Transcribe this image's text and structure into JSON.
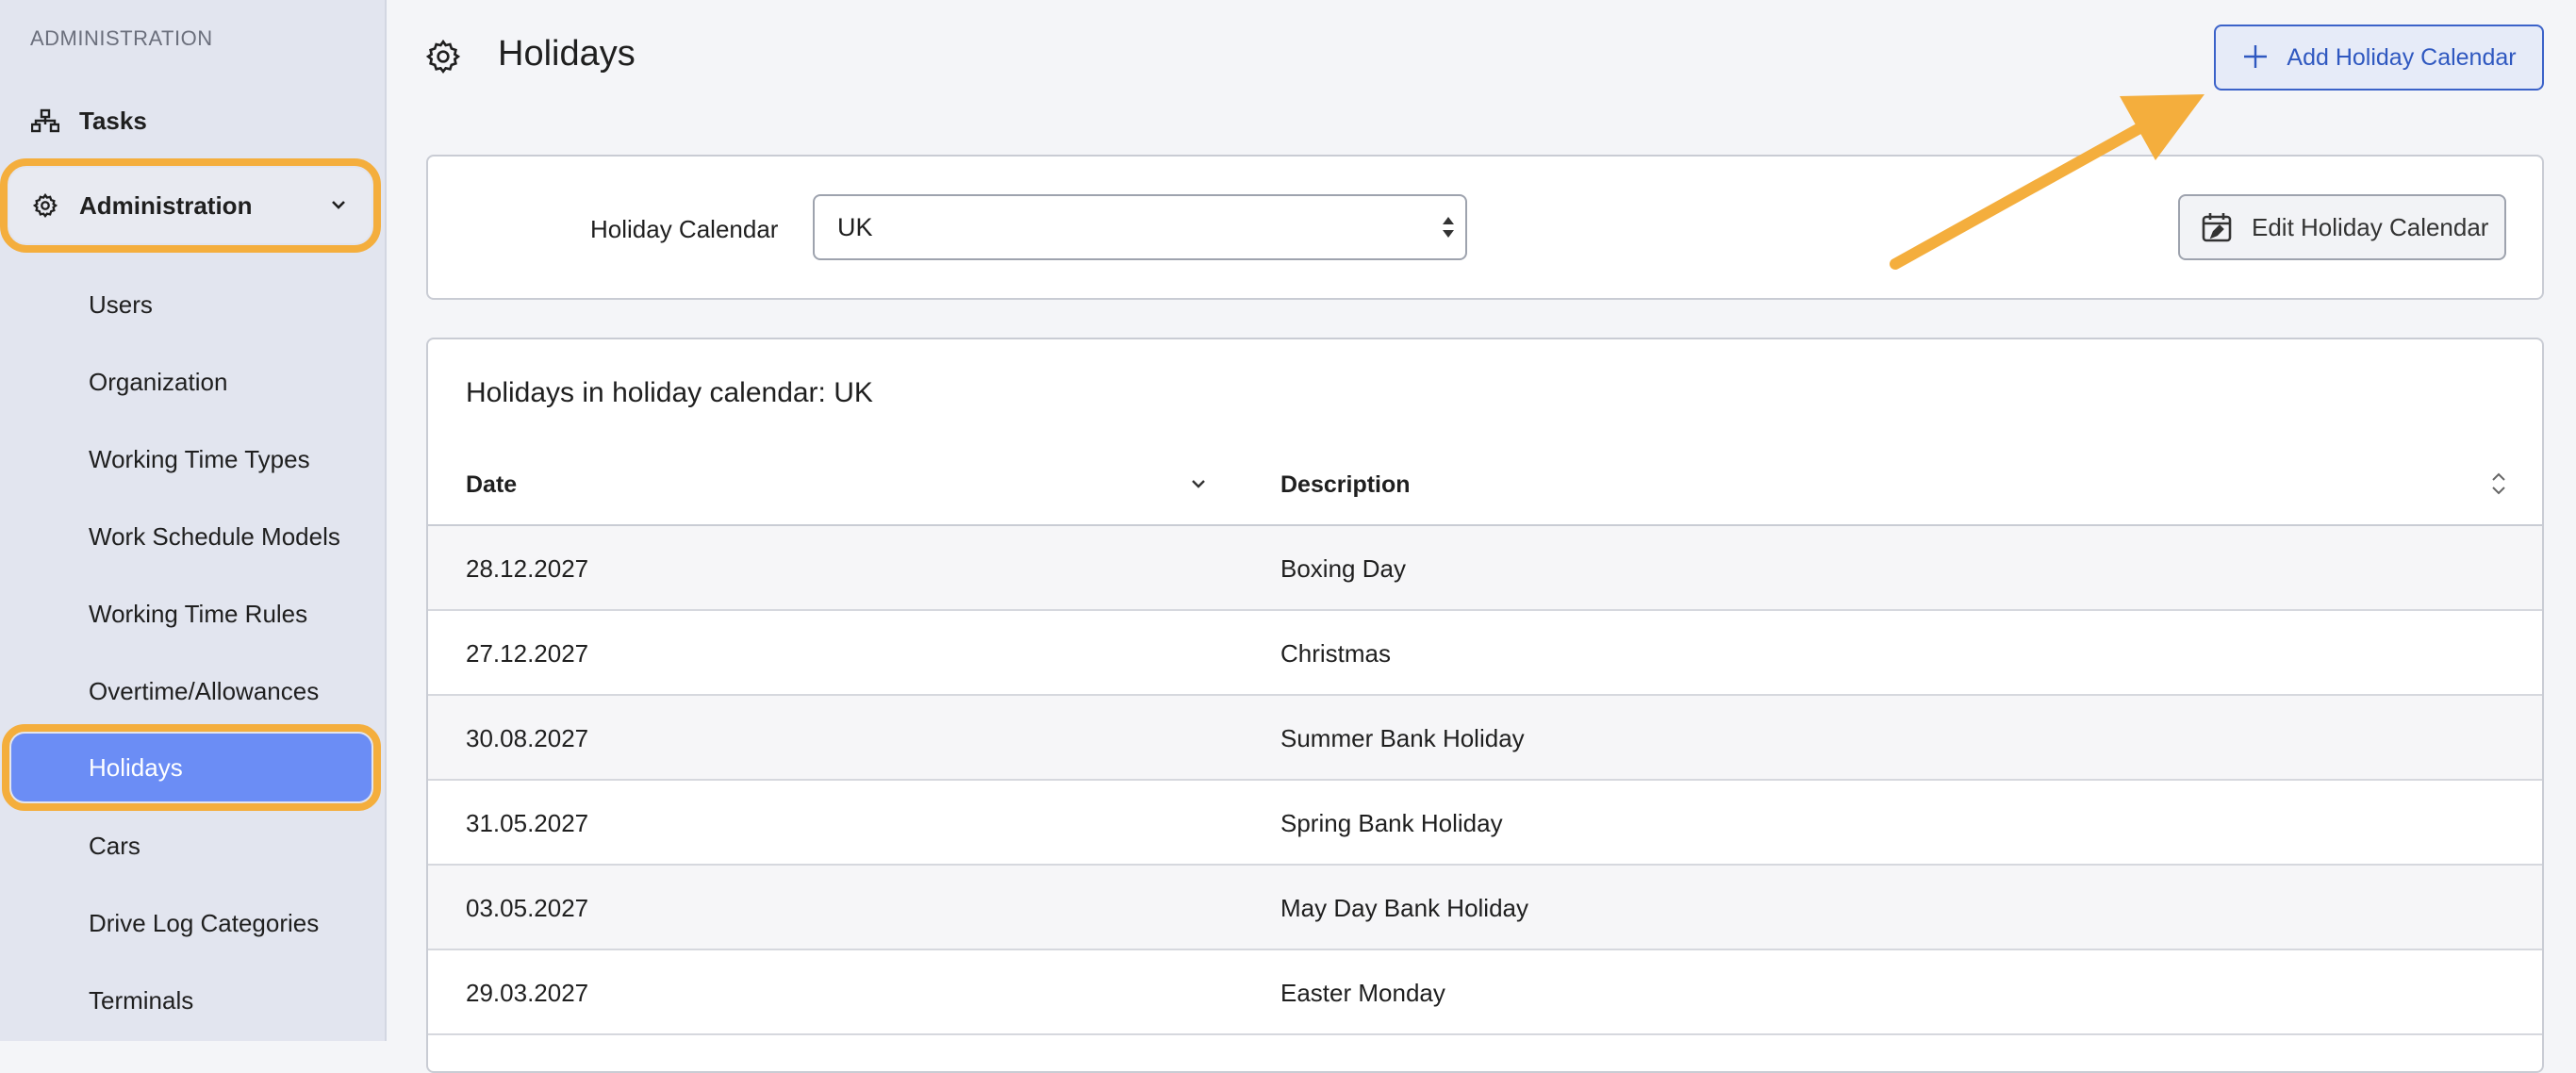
{
  "sidebar": {
    "section_label": "ADMINISTRATION",
    "tasks_label": "Tasks",
    "admin_label": "Administration",
    "items": [
      {
        "label": "Users"
      },
      {
        "label": "Organization"
      },
      {
        "label": "Working Time Types"
      },
      {
        "label": "Work Schedule Models"
      },
      {
        "label": "Working Time Rules"
      },
      {
        "label": "Overtime/Allowances"
      },
      {
        "label": "Holidays"
      },
      {
        "label": "Cars"
      },
      {
        "label": "Drive Log Categories"
      },
      {
        "label": "Terminals"
      }
    ]
  },
  "header": {
    "title": "Holidays",
    "add_button": "Add Holiday Calendar"
  },
  "filter": {
    "label": "Holiday Calendar",
    "selected": "UK",
    "edit_button": "Edit Holiday Calendar"
  },
  "table": {
    "caption": "Holidays in holiday calendar: UK",
    "columns": [
      "Date",
      "Description"
    ],
    "rows": [
      {
        "date": "28.12.2027",
        "description": "Boxing Day"
      },
      {
        "date": "27.12.2027",
        "description": "Christmas"
      },
      {
        "date": "30.08.2027",
        "description": "Summer Bank Holiday"
      },
      {
        "date": "31.05.2027",
        "description": "Spring Bank Holiday"
      },
      {
        "date": "03.05.2027",
        "description": "May Day Bank Holiday"
      },
      {
        "date": "29.03.2027",
        "description": "Easter Monday"
      }
    ]
  },
  "colors": {
    "accent": "#3b62c9",
    "active_nav": "#6b8df5",
    "highlight": "#f4ae3d"
  },
  "icons": [
    "tasks-icon",
    "gear-icon",
    "chevron-down-icon",
    "plus-icon",
    "calendar-edit-icon",
    "select-arrows-icon",
    "sort-desc-icon",
    "sort-both-icon",
    "annotation-arrow"
  ]
}
